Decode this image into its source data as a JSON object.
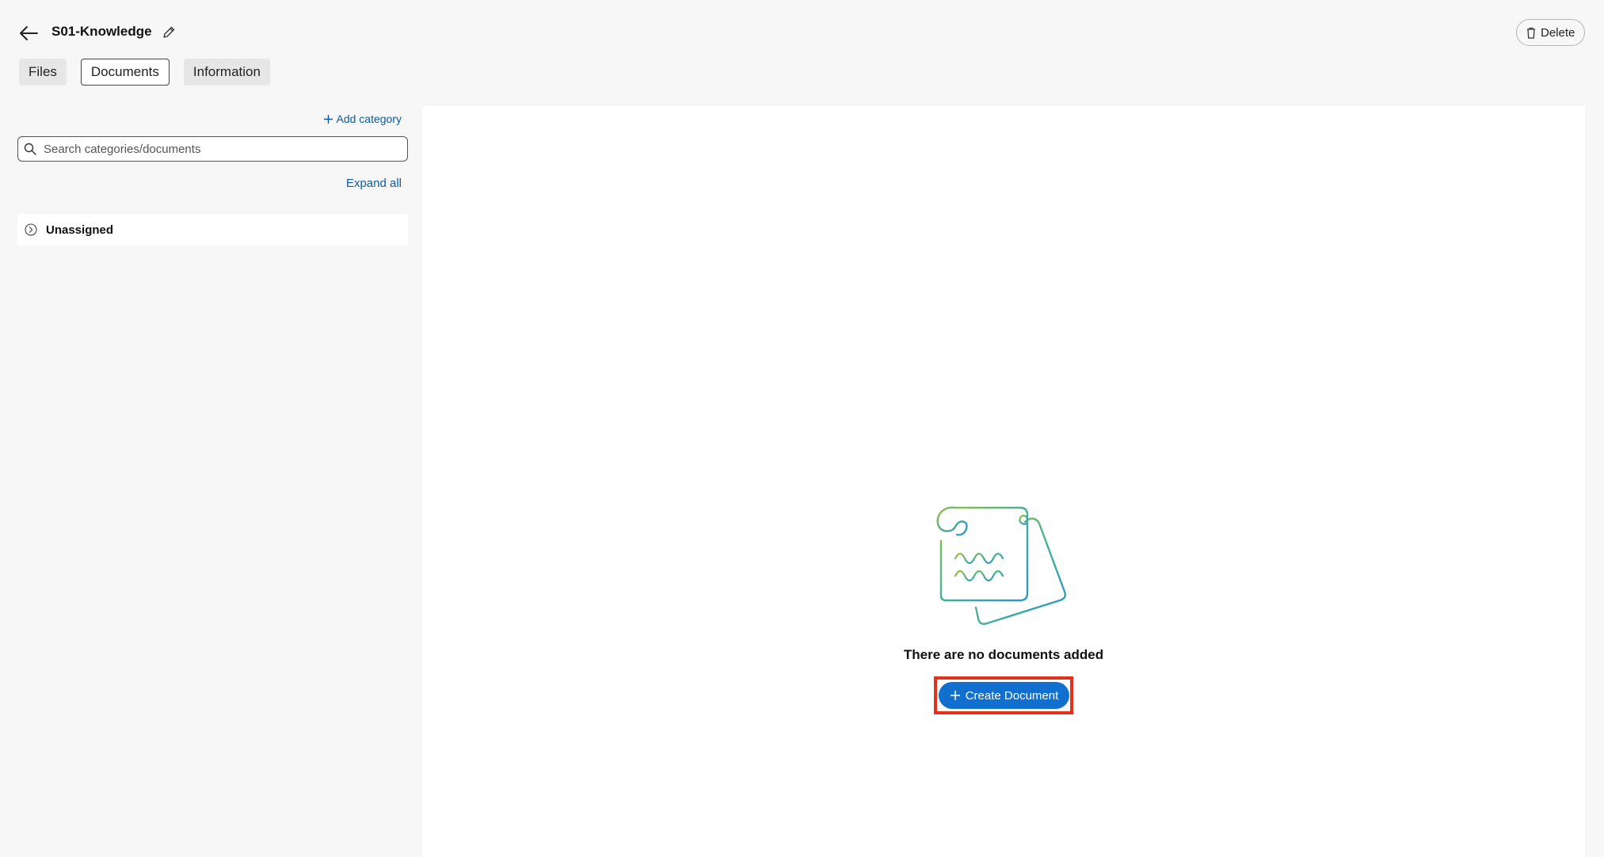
{
  "header": {
    "title": "S01-Knowledge",
    "delete_label": "Delete"
  },
  "tabs": [
    {
      "label": "Files",
      "active": false
    },
    {
      "label": "Documents",
      "active": true
    },
    {
      "label": "Information",
      "active": false
    }
  ],
  "sidebar": {
    "add_category_label": "Add category",
    "search_placeholder": "Search categories/documents",
    "expand_all_label": "Expand all",
    "categories": [
      {
        "label": "Unassigned"
      }
    ]
  },
  "main": {
    "empty_message": "There are no documents added",
    "create_button_label": "Create Document"
  },
  "colors": {
    "accent": "#1170cf",
    "link": "#0b5a9e",
    "highlight": "#e2311d"
  },
  "icons": [
    "back-arrow-icon",
    "pencil-icon",
    "trash-icon",
    "plus-icon",
    "search-icon",
    "chevron-right-circle-icon",
    "empty-documents-illustration"
  ]
}
